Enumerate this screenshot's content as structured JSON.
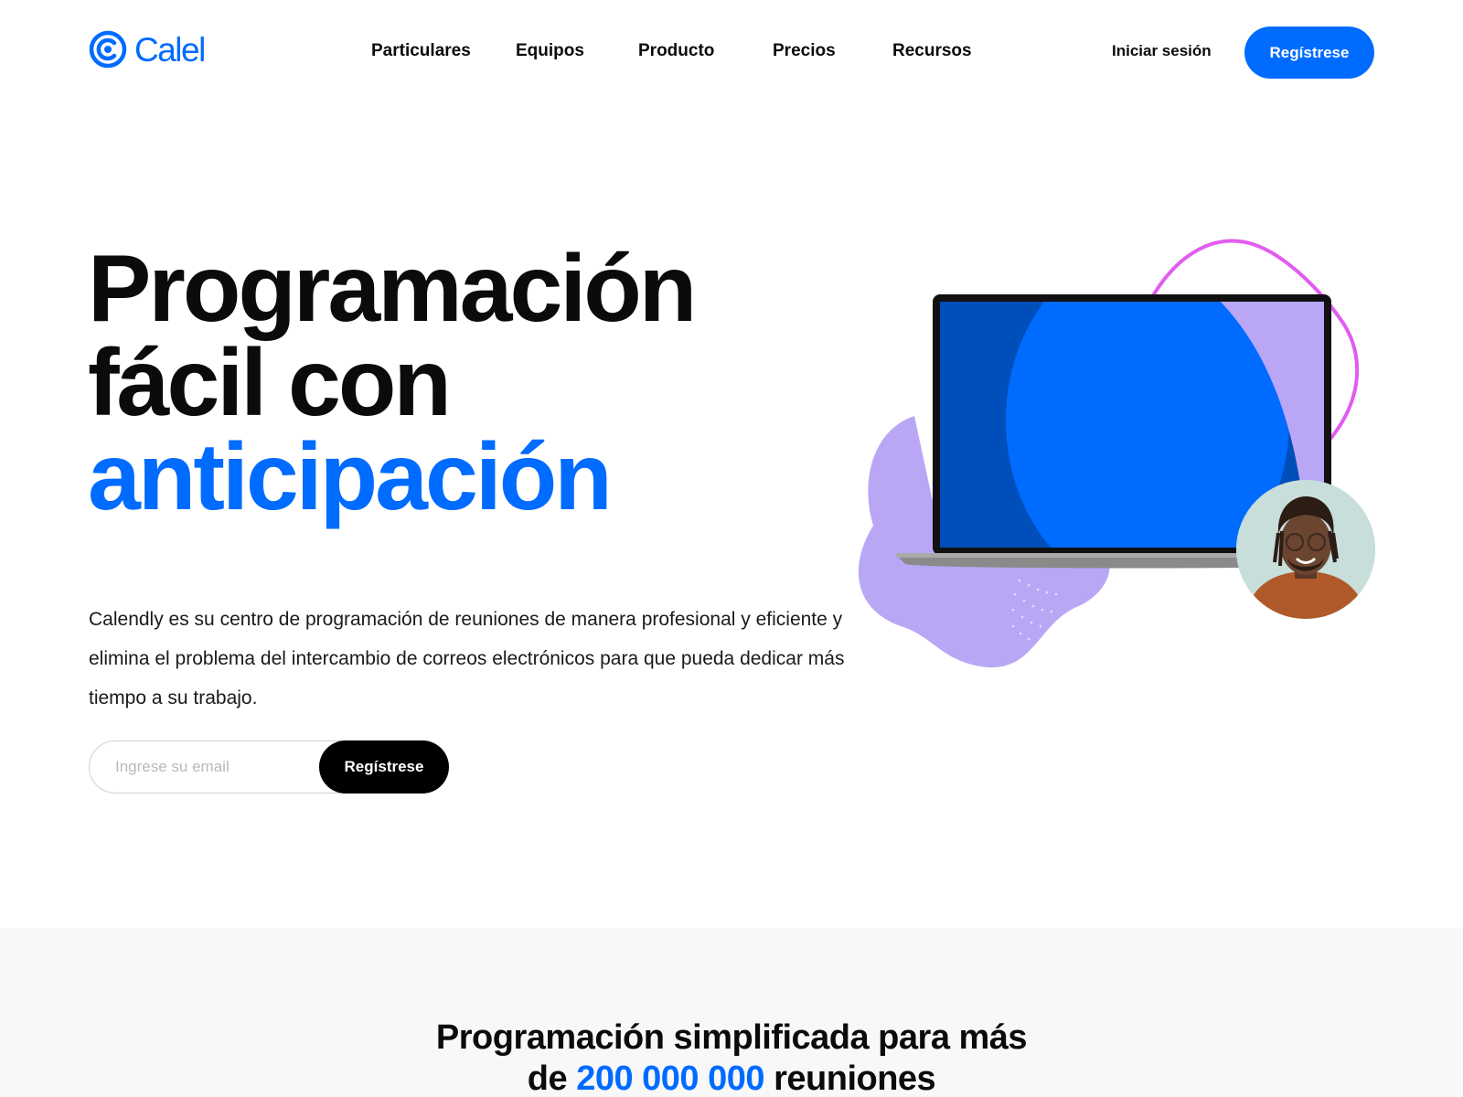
{
  "brand": {
    "logo_text": "Calel",
    "color": "#006bff"
  },
  "nav": {
    "items": [
      {
        "label": "Particulares"
      },
      {
        "label": "Equipos"
      },
      {
        "label": "Producto"
      },
      {
        "label": "Precios"
      },
      {
        "label": "Recursos"
      }
    ],
    "login_label": "Iniciar sesión",
    "signup_label": "Regístrese"
  },
  "hero": {
    "title_line1": "Programación",
    "title_line2": "fácil con",
    "title_line3": "anticipación",
    "description": "Calendly es su centro de programación de reuniones de manera profesional y eficiente y elimina el problema del intercambio de correos electrónicos para que pueda dedicar más tiempo a su trabajo.",
    "email_placeholder": "Ingrese su email",
    "signup_label": "Regístrese"
  },
  "stats": {
    "title_prefix": "Programación simplificada para más",
    "title_de": "de",
    "title_number": "200 000 000",
    "title_suffix": "reuniones"
  },
  "colors": {
    "accent": "#006bff",
    "lavender": "#b9a7f5",
    "magenta": "#e15cf0",
    "dark_button": "#000000"
  }
}
